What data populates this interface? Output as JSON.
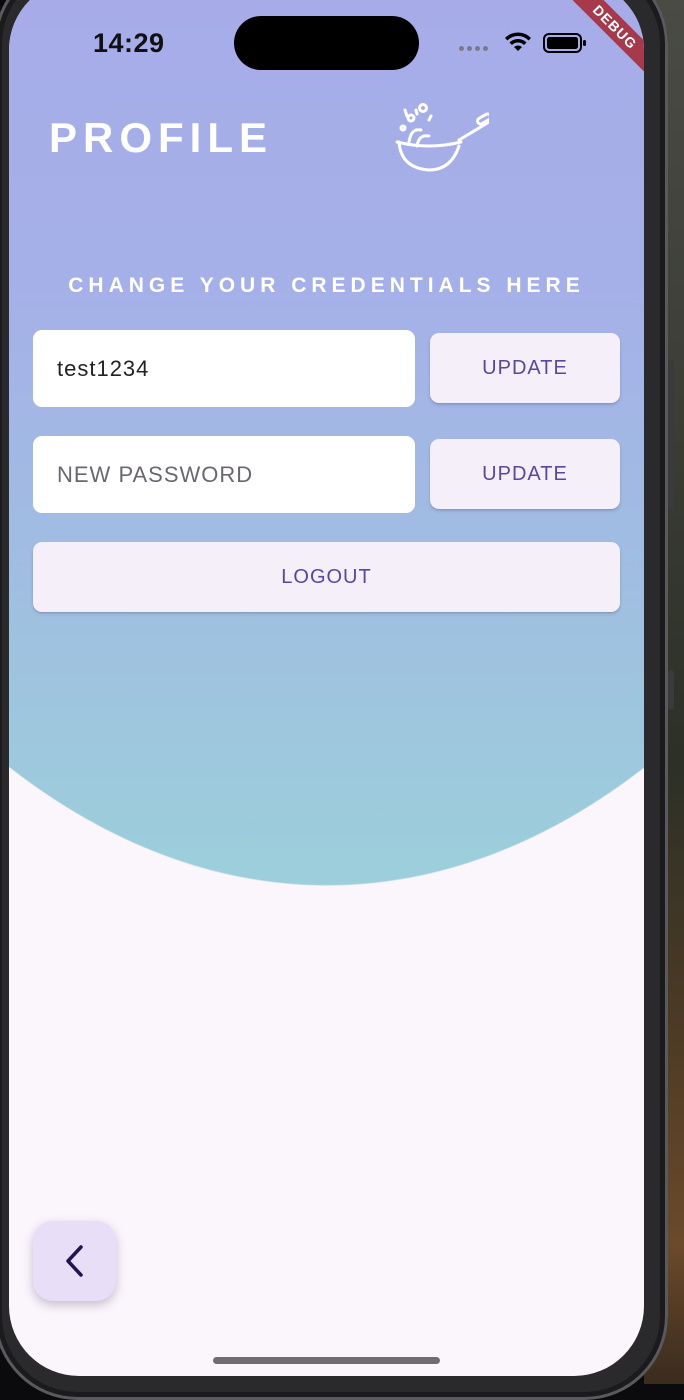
{
  "status_bar": {
    "time": "14:29"
  },
  "debug_banner": "DEBUG",
  "header": {
    "title": "PROFILE",
    "logo_icon": "wok-tossing-icon"
  },
  "credentials": {
    "heading": "CHANGE YOUR CREDENTIALS HERE",
    "username_field": {
      "value": "test1234",
      "placeholder": ""
    },
    "username_update_label": "UPDATE",
    "password_field": {
      "value": "",
      "placeholder": "NEW PASSWORD"
    },
    "password_update_label": "UPDATE",
    "logout_label": "LOGOUT"
  },
  "navigation": {
    "back_icon": "chevron-left-icon"
  },
  "colors": {
    "gradient_top": "#a7ace9",
    "gradient_bottom": "#9ccedb",
    "page_background": "#fbf5fc",
    "button_text": "#5b479b",
    "button_background": "#f4eff8",
    "fab_background": "#e8def8",
    "debug_ribbon": "#a6394b"
  }
}
